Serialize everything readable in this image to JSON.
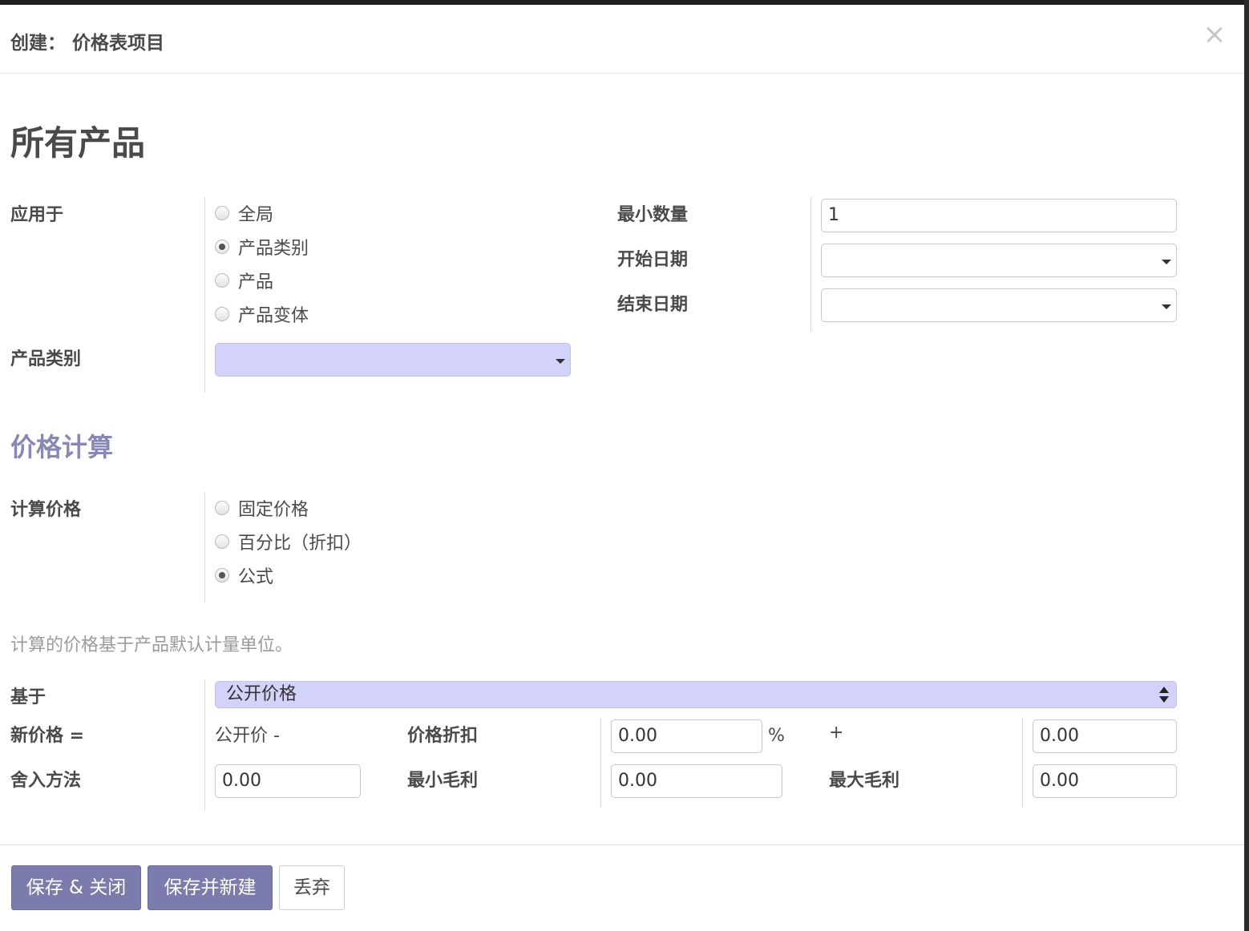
{
  "dialog": {
    "title": "创建： 价格表项目",
    "close_glyph": "×"
  },
  "record": {
    "name": "所有产品"
  },
  "apply_on": {
    "label": "应用于",
    "options": [
      {
        "label": "全局",
        "selected": false
      },
      {
        "label": "产品类别",
        "selected": true
      },
      {
        "label": "产品",
        "selected": false
      },
      {
        "label": "产品变体",
        "selected": false
      }
    ]
  },
  "product_category": {
    "label": "产品类别",
    "value": ""
  },
  "min_quantity": {
    "label": "最小数量",
    "value": "1"
  },
  "date_start": {
    "label": "开始日期",
    "value": ""
  },
  "date_end": {
    "label": "结束日期",
    "value": ""
  },
  "price_computation": {
    "section_title": "价格计算",
    "label": "计算价格",
    "options": [
      {
        "label": "固定价格",
        "selected": false
      },
      {
        "label": "百分比（折扣）",
        "selected": false
      },
      {
        "label": "公式",
        "selected": true
      }
    ]
  },
  "help_text": "计算的价格基于产品默认计量单位。",
  "formula": {
    "based_on_label": "基于",
    "based_on_value": "公开价格",
    "new_price_label": "新价格 =",
    "public_price_minus": "公开价 -",
    "discount_label": "价格折扣",
    "discount_value": "0.00",
    "percent_sign": "%",
    "plus_sign": "+",
    "surcharge_value": "0.00",
    "rounding_label": "舍入方法",
    "rounding_value": "0.00",
    "min_margin_label": "最小毛利",
    "min_margin_value": "0.00",
    "max_margin_label": "最大毛利",
    "max_margin_value": "0.00"
  },
  "footer": {
    "save_close": "保存 & 关闭",
    "save_new": "保存并新建",
    "discard": "丢弃"
  },
  "colors": {
    "primary": "#7c7bad",
    "section_title": "#8787b8",
    "required_field": "#d2d2fa"
  }
}
